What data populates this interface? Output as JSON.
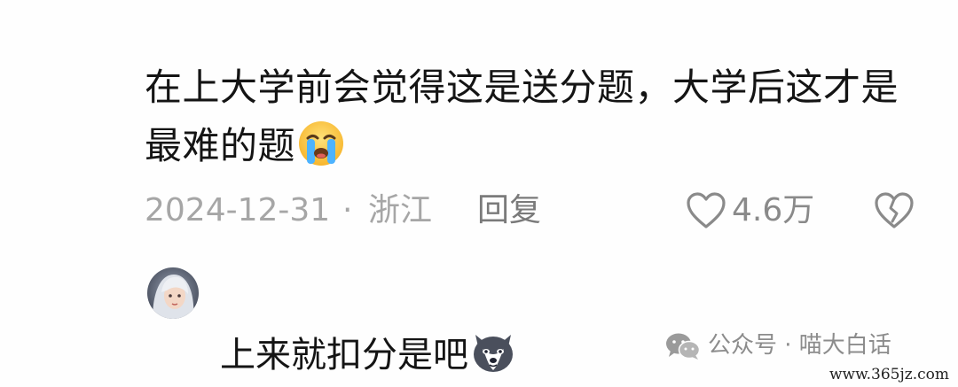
{
  "comment": {
    "text": "在上大学前会觉得这是送分题，大学后这才是最难的题",
    "emoji": "crying-face-icon",
    "date": "2024-12-31",
    "separator": "·",
    "location": "浙江",
    "reply_label": "回复",
    "like_count": "4.6万"
  },
  "reply": {
    "avatar": "avatar",
    "text": "上来就扣分是吧",
    "emoji": "husky-dog-icon"
  },
  "watermark": {
    "icon": "wechat-icon",
    "text": "公众号 · 喵大白话"
  },
  "site_mark": "www.365jz.com",
  "colors": {
    "text": "#141414",
    "meta": "#a6a6a6",
    "reply": "#7a7a7a",
    "watermark": "#8c8c8c"
  }
}
